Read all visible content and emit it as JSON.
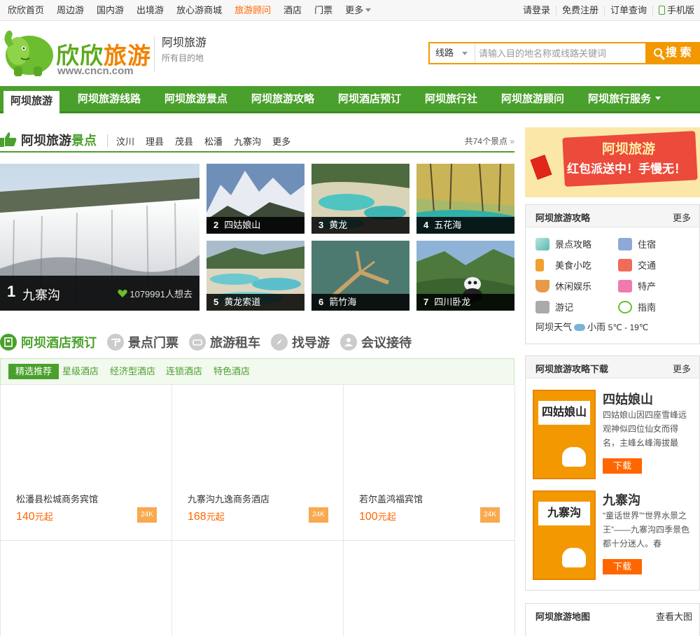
{
  "topnav": {
    "items": [
      "欣欣首页",
      "周边游",
      "国内游",
      "出境游",
      "放心游商城",
      "旅游顾问",
      "酒店",
      "门票"
    ],
    "more": "更多",
    "right": [
      "请登录",
      "免费注册",
      "订单查询",
      "手机版"
    ]
  },
  "header": {
    "logo_a": "欣欣",
    "logo_b": "旅游",
    "logo_url": "www.cncn.com",
    "site_title": "阿坝旅游",
    "site_sub": "所有目的地",
    "search_select": "线路",
    "search_placeholder": "请输入目的地名称或线路关键词",
    "search_button": "搜 索"
  },
  "mainnav": [
    "阿坝旅游",
    "阿坝旅游线路",
    "阿坝旅游景点",
    "阿坝旅游攻略",
    "阿坝酒店预订",
    "阿坝旅行社",
    "阿坝旅游顾问",
    "阿坝旅行服务"
  ],
  "scenic": {
    "title_a": "阿坝旅游",
    "title_b": "景点",
    "tabs": [
      "汶川",
      "理县",
      "茂县",
      "松潘",
      "九寨沟",
      "更多"
    ],
    "count": "共74个景点",
    "top": {
      "num": "1",
      "name": "九寨沟",
      "likes": "1079991",
      "likes_suffix": "人想去"
    },
    "spots": [
      {
        "num": "2",
        "name": "四姑娘山"
      },
      {
        "num": "3",
        "name": "黄龙"
      },
      {
        "num": "4",
        "name": "五花海"
      },
      {
        "num": "5",
        "name": "黄龙索道"
      },
      {
        "num": "6",
        "name": "箭竹海"
      },
      {
        "num": "7",
        "name": "四川卧龙"
      }
    ]
  },
  "services": [
    "阿坝酒店预订",
    "景点门票",
    "旅游租车",
    "找导游",
    "会议接待"
  ],
  "hotel_tabs": [
    "精选推荐",
    "星级酒店",
    "经济型酒店",
    "连锁酒店",
    "特色酒店"
  ],
  "hotels": [
    {
      "name": "松潘县松城商务宾馆",
      "price": "140",
      "unit": "元起",
      "badge": "24K"
    },
    {
      "name": "九寨沟九逸商务酒店",
      "price": "168",
      "unit": "元起",
      "badge": "24K"
    },
    {
      "name": "若尔盖鸿福宾馆",
      "price": "100",
      "unit": "元起",
      "badge": "24K"
    }
  ],
  "banner": {
    "line1": "阿坝旅游",
    "line2": "红包派送中！手慢无！"
  },
  "guide": {
    "title": "阿坝旅游攻略",
    "more": "更多",
    "items": [
      "景点攻略",
      "住宿",
      "美食小吃",
      "交通",
      "休闲娱乐",
      "特产",
      "游记",
      "指南"
    ],
    "weather_label": "阿坝天气",
    "weather": "小雨",
    "temp": "5℃ - 19℃"
  },
  "downloads": {
    "title": "阿坝旅游攻略下载",
    "more": "更多",
    "items": [
      {
        "cover": "四姑娘山",
        "name": "四姑娘山",
        "desc": "四姑娘山因四座雪峰远观神似四位仙女而得名，主峰幺峰海拔最",
        "button": "下载"
      },
      {
        "cover": "九寨沟",
        "name": "九寨沟",
        "desc": "“童话世界”“世界水景之王”——九寨沟四季景色都十分迷人。春",
        "button": "下载"
      }
    ]
  },
  "map": {
    "title": "阿坝旅游地图",
    "more": "查看大图"
  }
}
